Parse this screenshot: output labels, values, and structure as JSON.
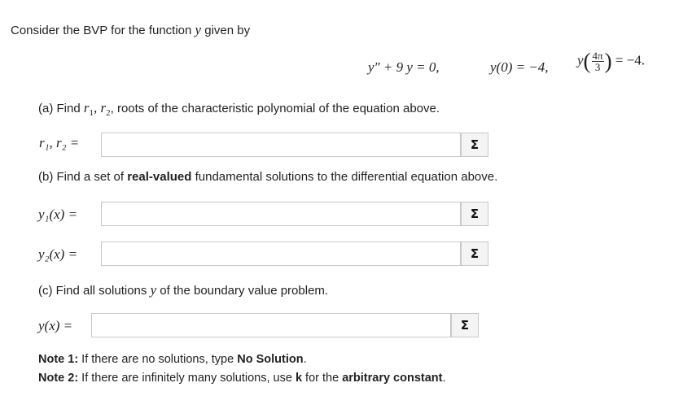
{
  "intro": {
    "text_before": "Consider the BVP for the function ",
    "var": "y",
    "text_after": " given by"
  },
  "equation": {
    "ode_lhs": "y″ + 9 y = 0,",
    "bc1": "y(0) = −4,",
    "bc2_fn": "y",
    "bc2_num": "4π",
    "bc2_den": "3",
    "bc2_rhs": "= −4."
  },
  "part_a": {
    "prompt_start": "(a) Find ",
    "prompt_vars": "r",
    "sub1": "1",
    "sub2": "2",
    "prompt_end": ", roots of the characteristic polynomial of the equation above.",
    "label": "r₁, r₂ =",
    "input_value": ""
  },
  "part_b": {
    "prompt_start": "(b) Find a set of ",
    "prompt_bold": "real-valued",
    "prompt_end": " fundamental solutions to the differential equation above.",
    "label1": "y₁(x) =",
    "label2": "y₂(x) =",
    "input1_value": "",
    "input2_value": ""
  },
  "part_c": {
    "prompt_start": "(c) Find all solutions ",
    "prompt_var": "y",
    "prompt_end": " of the boundary value problem.",
    "label": "y(x) =",
    "input_value": ""
  },
  "notes": {
    "note1_label": "Note 1:",
    "note1_text_a": " If there are no solutions, type ",
    "note1_bold": "No Solution",
    "note1_text_b": ".",
    "note2_label": "Note 2:",
    "note2_text_a": " If there are infinitely many solutions, use ",
    "note2_bold1": "k",
    "note2_text_b": " for the ",
    "note2_bold2": "arbitrary constant",
    "note2_text_c": "."
  },
  "sigma_symbol": "Σ",
  "icons": {
    "equation_editor": "sigma-icon"
  }
}
